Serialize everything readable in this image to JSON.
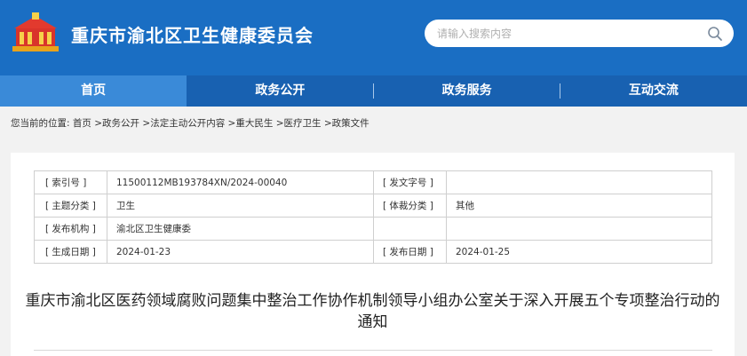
{
  "header": {
    "site_title": "重庆市渝北区卫生健康委员会",
    "logo_icon": "government-building-logo-icon",
    "search": {
      "placeholder": "请输入搜索内容",
      "icon": "search-icon"
    }
  },
  "nav": {
    "items": [
      {
        "label": "首页",
        "active": true
      },
      {
        "label": "政务公开",
        "active": false
      },
      {
        "label": "政务服务",
        "active": false
      },
      {
        "label": "互动交流",
        "active": false
      }
    ]
  },
  "breadcrumb": {
    "prefix": "您当前的位置:",
    "items": [
      "首页",
      "政务公开",
      "法定主动公开内容",
      "重大民生",
      "医疗卫生",
      "政策文件"
    ],
    "separator": ">"
  },
  "meta_table": {
    "rows": [
      {
        "label1": "[ 索引号 ]",
        "value1": "11500112MB193784XN/2024-00040",
        "label2": "[ 发文字号 ]",
        "value2": ""
      },
      {
        "label1": "[ 主题分类 ]",
        "value1": "卫生",
        "label2": "[ 体裁分类 ]",
        "value2": "其他"
      },
      {
        "label1": "[ 发布机构 ]",
        "value1": "渝北区卫生健康委",
        "label2": "",
        "value2": ""
      },
      {
        "label1": "[ 生成日期 ]",
        "value1": "2024-01-23",
        "label2": "[ 发布日期 ]",
        "value2": "2024-01-25"
      }
    ]
  },
  "document": {
    "title": "重庆市渝北区医药领域腐败问题集中整治工作协作机制领导小组办公室关于深入开展五个专项整治行动的通知"
  },
  "colors": {
    "header_bg": "#1a6ec3",
    "nav_bg": "#1861b1",
    "nav_active": "#3a8ad8",
    "page_bg": "#f2f2f2"
  }
}
